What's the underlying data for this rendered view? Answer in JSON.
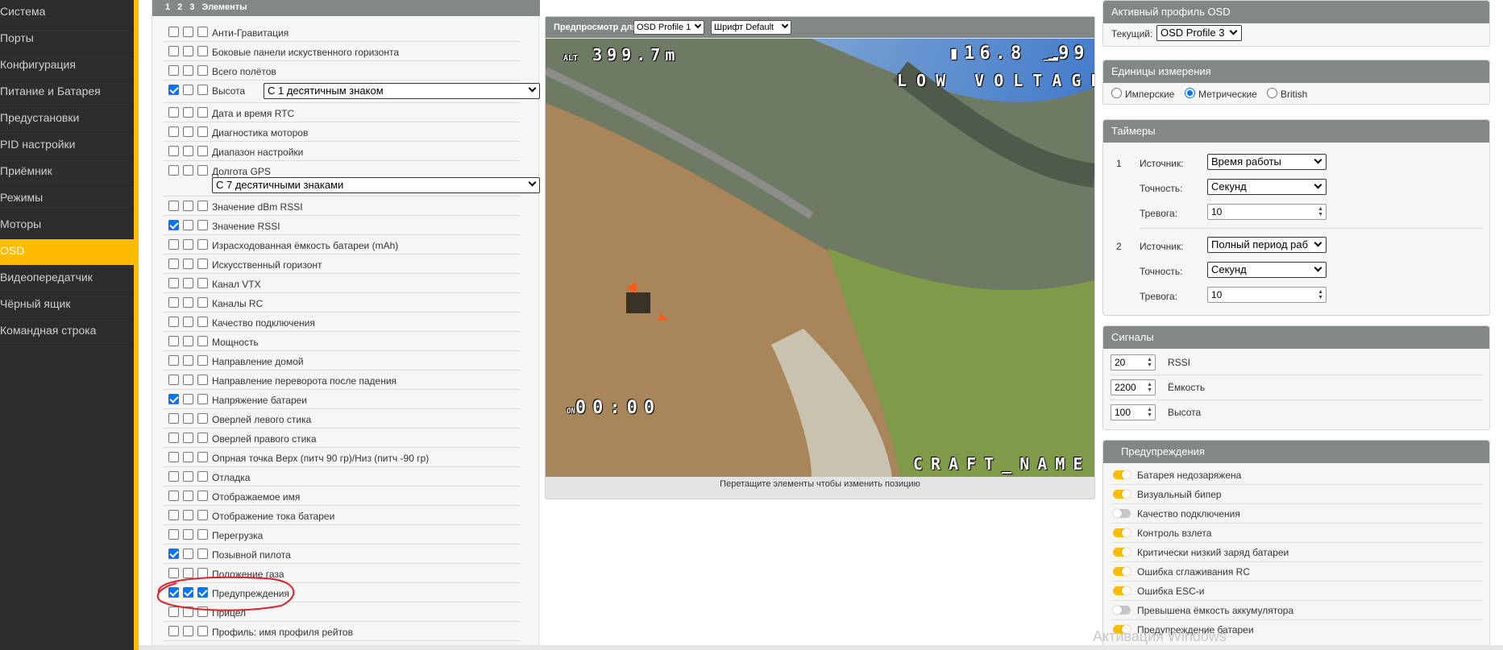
{
  "sidebar": {
    "items": [
      {
        "label": "Система"
      },
      {
        "label": "Порты"
      },
      {
        "label": "Конфигурация"
      },
      {
        "label": "Питание и Батарея"
      },
      {
        "label": "Предустановки"
      },
      {
        "label": "PID настройки"
      },
      {
        "label": "Приёмник"
      },
      {
        "label": "Режимы"
      },
      {
        "label": "Моторы"
      },
      {
        "label": "OSD",
        "active": true
      },
      {
        "label": "Видеопередатчик"
      },
      {
        "label": "Чёрный ящик"
      },
      {
        "label": "Командная строка"
      }
    ]
  },
  "elements": {
    "header": "1 2 3 Элементы",
    "rows": [
      {
        "label": "Анти-Гравитация",
        "checks": [
          false,
          false,
          false
        ]
      },
      {
        "label": "Боковые панели искуственного горизонта",
        "checks": [
          false,
          false,
          false
        ]
      },
      {
        "label": "Всего полётов",
        "checks": [
          false,
          false,
          false
        ]
      },
      {
        "label": "Высота",
        "checks": [
          true,
          false,
          false
        ],
        "select": "С 1 десятичным знаком"
      },
      {
        "label": "Дата и время RTC",
        "checks": [
          false,
          false,
          false
        ]
      },
      {
        "label": "Диагностика моторов",
        "checks": [
          false,
          false,
          false
        ]
      },
      {
        "label": "Диапазон настройки",
        "checks": [
          false,
          false,
          false
        ]
      },
      {
        "label": "Долгота GPS",
        "checks": [
          false,
          false,
          false
        ],
        "select": "С 7 десятичными знаками"
      },
      {
        "label": "Значение dBm RSSI",
        "checks": [
          false,
          false,
          false
        ]
      },
      {
        "label": "Значение RSSI",
        "checks": [
          true,
          false,
          false
        ]
      },
      {
        "label": "Израсходованная ёмкость батареи (mAh)",
        "checks": [
          false,
          false,
          false
        ]
      },
      {
        "label": "Искусственный горизонт",
        "checks": [
          false,
          false,
          false
        ]
      },
      {
        "label": "Канал VTX",
        "checks": [
          false,
          false,
          false
        ]
      },
      {
        "label": "Каналы RC",
        "checks": [
          false,
          false,
          false
        ]
      },
      {
        "label": "Качество подключения",
        "checks": [
          false,
          false,
          false
        ]
      },
      {
        "label": "Мощность",
        "checks": [
          false,
          false,
          false
        ]
      },
      {
        "label": "Направление домой",
        "checks": [
          false,
          false,
          false
        ]
      },
      {
        "label": "Направление переворота после падения",
        "checks": [
          false,
          false,
          false
        ]
      },
      {
        "label": "Напряжение батареи",
        "checks": [
          true,
          false,
          false
        ]
      },
      {
        "label": "Оверлей левого стика",
        "checks": [
          false,
          false,
          false
        ]
      },
      {
        "label": "Оверлей правого стика",
        "checks": [
          false,
          false,
          false
        ]
      },
      {
        "label": "Опрная точка Верх (питч 90 гр)/Низ (питч -90 гр)",
        "checks": [
          false,
          false,
          false
        ]
      },
      {
        "label": "Отладка",
        "checks": [
          false,
          false,
          false
        ]
      },
      {
        "label": "Отображаемое имя",
        "checks": [
          false,
          false,
          false
        ]
      },
      {
        "label": "Отображение тока батареи",
        "checks": [
          false,
          false,
          false
        ]
      },
      {
        "label": "Перегрузка",
        "checks": [
          false,
          false,
          false
        ]
      },
      {
        "label": "Позывной пилота",
        "checks": [
          true,
          false,
          false
        ]
      },
      {
        "label": "Положение газа",
        "checks": [
          false,
          false,
          false
        ]
      },
      {
        "label": "Предупреждения",
        "checks": [
          true,
          true,
          true
        ]
      },
      {
        "label": "Прицел",
        "checks": [
          false,
          false,
          false
        ]
      },
      {
        "label": "Профиль: имя профиля рейтов",
        "checks": [
          false,
          false,
          false
        ]
      }
    ]
  },
  "preview": {
    "label": "Предпросмотр для",
    "profile_select": "OSD Profile 1",
    "font_select": "Шрифт Default",
    "hint": "Перетащите элементы чтобы изменить позицию",
    "osd": {
      "altitude": "399.7m",
      "battery": "16.8",
      "rssi": "99",
      "warning": "LOW VOLTAGE",
      "timer": "00:00",
      "craft_name": "CRAFT_NAME"
    }
  },
  "active_profile": {
    "title": "Активный профиль OSD",
    "current_label": "Текущий:",
    "current_value": "OSD Profile 3"
  },
  "units": {
    "title": "Единицы измерения",
    "options": [
      {
        "label": "Имперские",
        "selected": false
      },
      {
        "label": "Метрические",
        "selected": true
      },
      {
        "label": "British",
        "selected": false
      }
    ]
  },
  "timers": {
    "title": "Таймеры",
    "items": [
      {
        "index": "1",
        "source_label": "Источник:",
        "source": "Время работы",
        "precision_label": "Точность:",
        "precision": "Секунд",
        "alarm_label": "Тревога:",
        "alarm": "10"
      },
      {
        "index": "2",
        "source_label": "Источник:",
        "source": "Полный период раб",
        "precision_label": "Точность:",
        "precision": "Секунд",
        "alarm_label": "Тревога:",
        "alarm": "10"
      }
    ]
  },
  "alarms": {
    "title": "Сигналы",
    "items": [
      {
        "value": "20",
        "label": "RSSI"
      },
      {
        "value": "2200",
        "label": "Ёмкость"
      },
      {
        "value": "100",
        "label": "Высота"
      }
    ]
  },
  "warnings": {
    "title": "Предупреждения",
    "items": [
      {
        "label": "Батарея недозаряжена",
        "on": true
      },
      {
        "label": "Визуальный бипер",
        "on": true
      },
      {
        "label": "Качество подключения",
        "on": false
      },
      {
        "label": "Контроль взлета",
        "on": true
      },
      {
        "label": "Критически низкий заряд батареи",
        "on": true
      },
      {
        "label": "Ошибка сглаживания RC",
        "on": true
      },
      {
        "label": "Ошибка ESC-и",
        "on": true
      },
      {
        "label": "Превышена ёмкость аккумулятора",
        "on": false
      },
      {
        "label": "Предупреждение батареи",
        "on": true
      }
    ]
  },
  "watermark": "Активация Windows",
  "colors": {
    "accent": "#ffbb00",
    "header": "#828885",
    "checkbox": "#0075ff",
    "annotation": "#e0202a"
  }
}
